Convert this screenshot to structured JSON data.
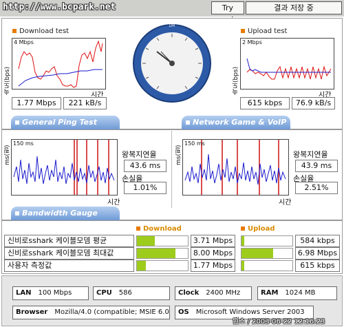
{
  "header": {
    "logo": "http://www.bcpark.net",
    "try_again": "Try again",
    "save_result": "결과 저장 중"
  },
  "download": {
    "title": "Download test",
    "ylabel": "속도(bps)",
    "ymax": "4 Mbps",
    "xlabel": "시간",
    "mbps": "1.77 Mbps",
    "kbs": "221 kB/s"
  },
  "upload": {
    "title": "Upload test",
    "ylabel": "속도(bps)",
    "ymax": "2 Mbps",
    "xlabel": "시간",
    "kbps": "615 kbps",
    "kbs": "76.9 kB/s"
  },
  "gauge": {
    "ticks": [
      "0",
      "10k",
      "100k",
      "1M",
      "2M",
      "4M",
      "8M",
      "10M",
      "40M",
      "80M",
      "100M"
    ]
  },
  "tabs": {
    "ping": "General Ping Test",
    "game": "Network Game & VoIP Test",
    "bandwidth": "Bandwidth Gauge"
  },
  "ping1": {
    "ylabel": "ms(핑)",
    "ymax": "150 ms",
    "xlabel": "시간",
    "rtt_label": "왕복지연율",
    "rtt": "43.6 ms",
    "loss_label": "손실율",
    "loss": "1.01%"
  },
  "ping2": {
    "ylabel": "ms(핑)",
    "ymax": "150 ms",
    "xlabel": "시간",
    "rtt_label": "왕복지연율",
    "rtt": "43.9 ms",
    "loss_label": "손실율",
    "loss": "2.51%"
  },
  "bandwidth": {
    "download_header": "Download",
    "upload_header": "Upload",
    "rows": [
      {
        "label": "신비로sshark 케이블모뎀 평균",
        "down": "3.71 Mbps",
        "down_fill": 0.35,
        "up": "584 kbps",
        "up_fill": 0.06
      },
      {
        "label": "신비로sshark 케이블모뎀 최대값",
        "down": "8.00 Mbps",
        "down_fill": 0.76,
        "up": "6.98 Mbps",
        "up_fill": 0.62
      },
      {
        "label": "사용자 측정값",
        "down": "1.77 Mbps",
        "down_fill": 0.17,
        "up": "615 kbps",
        "up_fill": 0.06
      }
    ]
  },
  "system": {
    "lan_label": "LAN",
    "lan": "100 Mbps",
    "cpu_label": "CPU",
    "cpu": "586",
    "clock_label": "Clock",
    "clock": "2400 MHz",
    "ram_label": "RAM",
    "ram": "1024 MB",
    "browser_label": "Browser",
    "browser": "Mozilla/4.0 (compatible; MSIE 6.0",
    "os_label": "OS",
    "os": "Microsoft Windows Server 2003"
  },
  "footer": {
    "timestamp": "윈스 / 2003-06-22 12:16:23"
  },
  "colors": {
    "download_line": "#dd1111",
    "upload_line": "#1a1acc",
    "bar": "#9ecc1d",
    "tab": "#6f9ad6"
  }
}
